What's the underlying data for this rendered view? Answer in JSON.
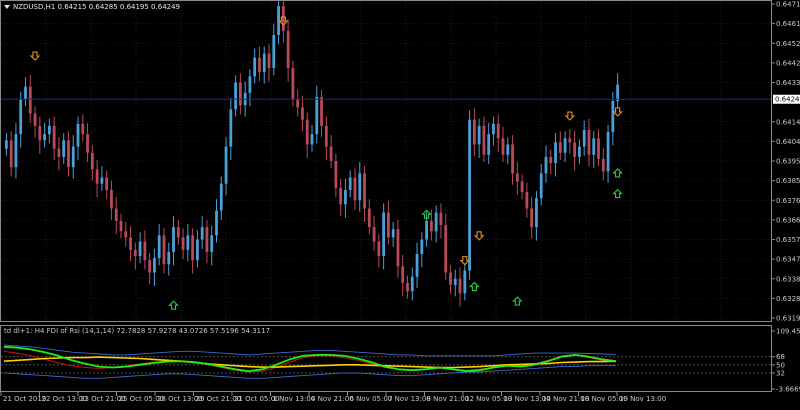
{
  "main_chart": {
    "symbol_line": "NZDUSD,H1  0.64215 0.64285 0.64195 0.64249",
    "price_axis": [
      "0.64710",
      "0.64615",
      "0.64520",
      "0.64425",
      "0.64330",
      "0.64140",
      "0.64045",
      "0.63950",
      "0.63855",
      "0.63760",
      "0.63665",
      "0.63570",
      "0.63475",
      "0.63380",
      "0.63285",
      "0.63190"
    ],
    "current_price": "0.64249",
    "price_range": [
      0.6319,
      0.6471
    ],
    "closes": [
      0.6405,
      0.6392,
      0.6408,
      0.6425,
      0.6431,
      0.6418,
      0.6412,
      0.6405,
      0.6408,
      0.6412,
      0.6401,
      0.6397,
      0.6405,
      0.6392,
      0.6402,
      0.6413,
      0.6408,
      0.6399,
      0.6391,
      0.6384,
      0.6387,
      0.6381,
      0.6372,
      0.6366,
      0.6361,
      0.6358,
      0.6352,
      0.6349,
      0.6356,
      0.6347,
      0.6341,
      0.6348,
      0.6359,
      0.6345,
      0.6351,
      0.6363,
      0.6358,
      0.6352,
      0.6359,
      0.6347,
      0.6357,
      0.6363,
      0.6351,
      0.6359,
      0.6371,
      0.6384,
      0.6402,
      0.642,
      0.6433,
      0.6422,
      0.6428,
      0.6436,
      0.6445,
      0.6438,
      0.6447,
      0.644,
      0.6456,
      0.647,
      0.6458,
      0.644,
      0.6425,
      0.6421,
      0.6415,
      0.6403,
      0.6408,
      0.6426,
      0.6412,
      0.6402,
      0.6395,
      0.6382,
      0.6374,
      0.6381,
      0.6387,
      0.6376,
      0.6389,
      0.6372,
      0.6363,
      0.6356,
      0.6349,
      0.637,
      0.6358,
      0.6362,
      0.6344,
      0.6336,
      0.6332,
      0.6339,
      0.635,
      0.6357,
      0.6366,
      0.6361,
      0.637,
      0.6364,
      0.6341,
      0.6335,
      0.6338,
      0.6331,
      0.6342,
      0.6415,
      0.6403,
      0.6412,
      0.6398,
      0.6408,
      0.6413,
      0.6406,
      0.6398,
      0.6403,
      0.6389,
      0.6385,
      0.638,
      0.6372,
      0.6363,
      0.6377,
      0.6389,
      0.6397,
      0.6394,
      0.6404,
      0.6399,
      0.6406,
      0.6404,
      0.6397,
      0.6402,
      0.641,
      0.6398,
      0.6406,
      0.6396,
      0.639,
      0.6409,
      0.6424,
      0.6432
    ],
    "sell_arrow_price_levels": [
      0.6439,
      0.6456,
      0.634,
      0.6352,
      0.641,
      0.6412
    ],
    "buy_arrow_price_levels": [
      0.6332,
      0.6341,
      0.6334,
      0.6376,
      0.6386,
      0.6396
    ]
  },
  "indicator": {
    "title": "td dl+1: H4 FDI of Rsi  (14,1,14) 72.7828 57.9278 43.0726 57.5196 54.3117",
    "axis_labels": [
      "109.4511",
      "68",
      "50",
      "32",
      "-3.6669"
    ],
    "range": [
      -3.6669,
      109.4511
    ],
    "levels": [
      68,
      50,
      32
    ],
    "yellow_line": [
      58,
      60,
      62,
      64,
      65,
      66,
      66,
      67,
      66,
      65,
      64,
      62,
      60,
      58,
      55,
      52,
      50,
      48,
      46,
      45,
      45,
      46,
      47,
      48,
      49,
      50,
      50,
      49,
      48,
      47,
      46,
      45,
      44,
      44,
      45,
      46,
      48,
      50,
      51,
      52,
      53,
      55,
      56,
      57,
      57,
      58
    ],
    "green_line": [
      90,
      88,
      84,
      78,
      70,
      60,
      52,
      46,
      44,
      46,
      50,
      54,
      57,
      58,
      56,
      52,
      46,
      40,
      36,
      40,
      50,
      62,
      70,
      72,
      72,
      70,
      64,
      56,
      46,
      40,
      38,
      40,
      44,
      40,
      36,
      38,
      44,
      48,
      46,
      50,
      58,
      68,
      72,
      68,
      62,
      58
    ],
    "blue_upper_line": [
      94,
      92,
      90,
      86,
      82,
      78,
      76,
      74,
      72,
      72,
      74,
      76,
      78,
      80,
      80,
      78,
      76,
      74,
      72,
      74,
      76,
      78,
      80,
      82,
      82,
      80,
      78,
      76,
      74,
      72,
      72,
      70,
      70,
      70,
      70,
      70,
      70,
      72,
      74,
      76,
      76,
      76,
      76,
      75,
      74,
      73
    ],
    "blue_lower_line": [
      32,
      30,
      28,
      26,
      24,
      22,
      20,
      20,
      22,
      24,
      26,
      28,
      30,
      30,
      28,
      26,
      24,
      22,
      20,
      20,
      22,
      24,
      26,
      28,
      30,
      32,
      32,
      30,
      28,
      26,
      26,
      28,
      30,
      32,
      34,
      34,
      36,
      38,
      40,
      42,
      44,
      46,
      46,
      48,
      48,
      48
    ],
    "red_line": [
      80,
      76,
      70,
      62,
      54,
      48,
      44,
      42,
      44,
      48,
      52,
      56,
      58,
      58,
      56,
      50,
      44,
      38,
      34,
      36,
      44,
      56,
      66,
      70,
      70,
      66,
      60,
      52,
      44,
      40,
      38,
      40,
      42,
      40,
      38,
      40,
      44,
      48,
      48,
      52,
      60,
      70,
      72,
      66,
      60,
      56
    ]
  },
  "time_axis": [
    "21 Oct 2019",
    "22 Oct 13:00",
    "23 Oct 21:00",
    "25 Oct 05:00",
    "28 Oct 13:00",
    "29 Oct 21:00",
    "31 Oct 05:00",
    "1 Nov 13:00",
    "4 Nov 21:00",
    "6 Nov 05:00",
    "7 Nov 13:00",
    "8 Nov 21:00",
    "12 Nov 05:00",
    "13 Nov 13:00",
    "14 Nov 21:00",
    "18 Nov 05:00",
    "19 Nov 13:00"
  ],
  "colors": {
    "background": "#000000",
    "grid": "#2a2a48",
    "candle_up": "#4aa0d8",
    "candle_down": "#b84a5a",
    "sell_arrow": "#e8901e",
    "buy_arrow": "#2ecc40",
    "price_line": "#1c2a8c",
    "axis_text": "#c8c8c8",
    "yellow": "#ffd000",
    "green": "#22ee11",
    "blue": "#3a6acc",
    "red": "#c01818",
    "level": "#5a5a5a"
  }
}
